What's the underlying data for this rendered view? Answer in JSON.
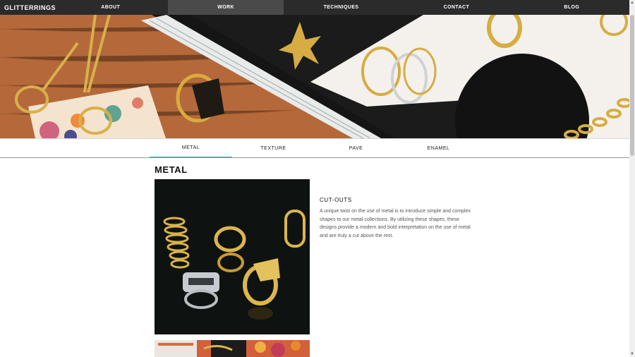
{
  "brand": "GLITTERRINGS",
  "nav": {
    "items": [
      {
        "label": "ABOUT",
        "active": false
      },
      {
        "label": "WORK",
        "active": true
      },
      {
        "label": "TECHNIQUES",
        "active": false
      },
      {
        "label": "CONTACT",
        "active": false
      },
      {
        "label": "BLOG",
        "active": false
      }
    ]
  },
  "subtabs": {
    "items": [
      {
        "label": "METAL",
        "active": true
      },
      {
        "label": "TEXTURE",
        "active": false
      },
      {
        "label": "PAVE",
        "active": false
      },
      {
        "label": "ENAMEL",
        "active": false
      }
    ]
  },
  "section": {
    "title": "METAL",
    "feature": {
      "title": "CUT-OUTS",
      "body": "A unique twist on the use of metal is to introduce simple and complex shapes to our metal collections. By utilizing these shapes, these designs provide a modern and bold interpretation on the use of metal and are truly a cut above the rest."
    }
  },
  "colors": {
    "nav_bg": "#2b2b2b",
    "nav_active": "#4a4a4a",
    "tab_accent": "#3ab3b8",
    "gold": "#d4a93a"
  }
}
